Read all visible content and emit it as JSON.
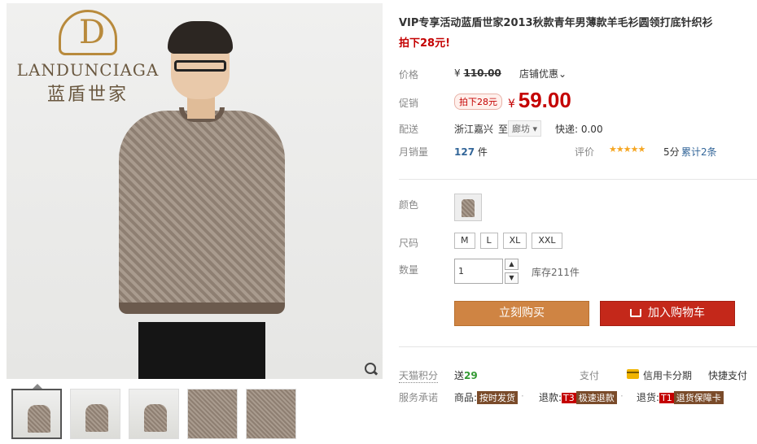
{
  "brand": {
    "en": "LANDUNCIAGA",
    "cn": "蓝盾世家"
  },
  "product": {
    "title": "VIP专享活动蓝盾世家2013秋款青年男薄款羊毛衫圆领打底针织衫",
    "promo_text": "拍下28元!"
  },
  "price": {
    "label": "价格",
    "old_currency": "¥",
    "old_value": "110.00",
    "store_promo": "店铺优惠",
    "promo_label": "促销",
    "promo_badge": "拍下28元",
    "currency": "¥",
    "value": "59.00"
  },
  "shipping": {
    "label": "配送",
    "from": "浙江嘉兴",
    "to_label": "至",
    "to": "廊坊",
    "fee": "快递: 0.00"
  },
  "sales": {
    "label": "月销量",
    "count": "127",
    "unit": "件",
    "rating_label": "评价",
    "stars": 5,
    "score": "5分",
    "reviews": "累计2条"
  },
  "options": {
    "color_label": "颜色",
    "size_label": "尺码",
    "sizes": [
      "M",
      "L",
      "XL",
      "XXL"
    ],
    "qty_label": "数量",
    "qty_value": "1",
    "stock": "库存211件"
  },
  "actions": {
    "buy_now": "立刻购买",
    "add_cart": "加入购物车"
  },
  "service": {
    "points_label": "天猫积分",
    "points_prefix": "送",
    "points_value": "29",
    "pay_label": "支付",
    "installment": "信用卡分期",
    "quick_pay": "快捷支付",
    "promise_label": "服务承诺",
    "p1_prefix": "商品:",
    "p1_tag": "按时发货",
    "p2_prefix": "退款:",
    "p2_code": "T3",
    "p2_tag": "极速退款",
    "p3_prefix": "退货:",
    "p3_code": "T1",
    "p3_tag": "退货保障卡"
  },
  "colors": {
    "price_red": "#c40000",
    "buy_orange": "#cf8443",
    "cart_red": "#c4281a",
    "star_gold": "#f5a623"
  },
  "icons": [
    "zoom-icon",
    "cart-icon",
    "card-icon",
    "chevron-down-icon",
    "arrow-up-icon",
    "arrow-down-icon"
  ]
}
